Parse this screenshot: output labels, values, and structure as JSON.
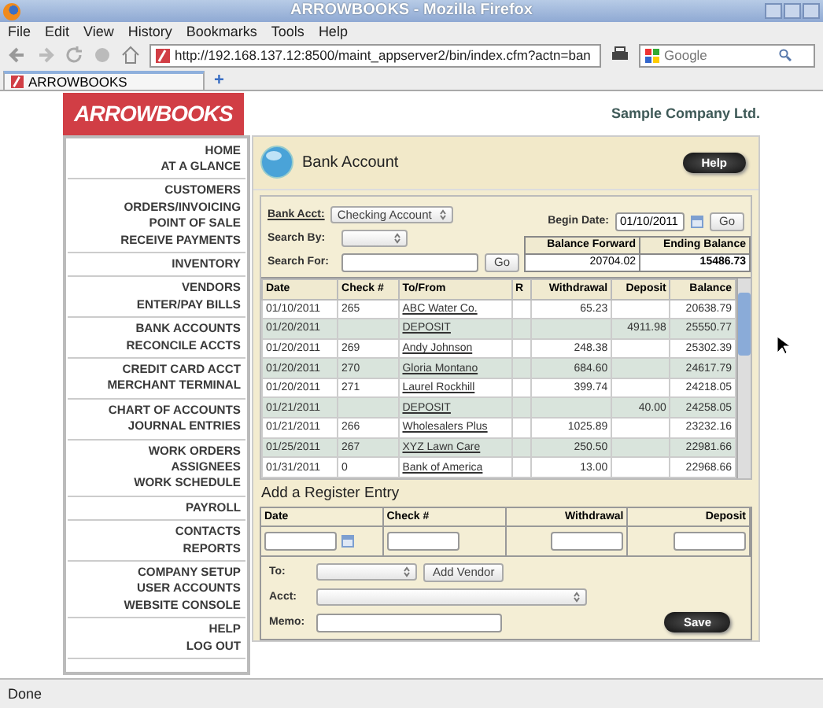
{
  "window": {
    "title": "ARROWBOOKS - Mozilla Firefox"
  },
  "menu": [
    "File",
    "Edit",
    "View",
    "History",
    "Bookmarks",
    "Tools",
    "Help"
  ],
  "address": {
    "value": "http://192.168.137.12:8500/maint_appserver2/bin/index.cfm?actn=ban"
  },
  "search": {
    "placeholder": "Google"
  },
  "tabs": [
    {
      "label": "ARROWBOOKS",
      "selected": true
    }
  ],
  "new_tab": "+",
  "header": {
    "logo": "ARROWBOOKS",
    "company": "Sample Company Ltd."
  },
  "sidebar": [
    [
      "HOME",
      "AT A GLANCE"
    ],
    [
      "CUSTOMERS",
      "ORDERS/INVOICING",
      "POINT OF SALE",
      "RECEIVE PAYMENTS"
    ],
    [
      "INVENTORY"
    ],
    [
      "VENDORS",
      "ENTER/PAY BILLS"
    ],
    [
      "BANK ACCOUNTS",
      "RECONCILE ACCTS"
    ],
    [
      "CREDIT CARD ACCT",
      "MERCHANT TERMINAL"
    ],
    [
      "CHART OF ACCOUNTS",
      "JOURNAL ENTRIES"
    ],
    [
      "WORK ORDERS",
      "ASSIGNEES",
      "WORK SCHEDULE"
    ],
    [
      "PAYROLL"
    ],
    [
      "CONTACTS",
      "REPORTS"
    ],
    [
      "COMPANY SETUP",
      "USER ACCOUNTS",
      "WEBSITE CONSOLE"
    ],
    [
      "HELP",
      "LOG OUT"
    ]
  ],
  "panel": {
    "title": "Bank Account",
    "help": "Help",
    "bank_acct": {
      "label": "Bank Acct:",
      "value": "Checking Account"
    },
    "search_by": {
      "label": "Search By:"
    },
    "search_for": {
      "label": "Search For:",
      "button": "Go"
    },
    "begin_date": {
      "label": "Begin Date:",
      "value": "01/10/2011",
      "button": "Go"
    },
    "balances": {
      "columns": [
        "Balance Forward",
        "Ending Balance"
      ],
      "values": [
        "20704.02",
        "15486.73"
      ]
    }
  },
  "register": {
    "columns": [
      "Date",
      "Check #",
      "To/From",
      "R",
      "Withdrawal",
      "Deposit",
      "Balance"
    ],
    "rows": [
      [
        "01/10/2011",
        "265",
        "ABC Water Co.",
        "",
        "65.23",
        "",
        "20638.79"
      ],
      [
        "01/20/2011",
        "",
        "DEPOSIT",
        "",
        "",
        "4911.98",
        "25550.77"
      ],
      [
        "01/20/2011",
        "269",
        "Andy Johnson",
        "",
        "248.38",
        "",
        "25302.39"
      ],
      [
        "01/20/2011",
        "270",
        "Gloria Montano",
        "",
        "684.60",
        "",
        "24617.79"
      ],
      [
        "01/20/2011",
        "271",
        "Laurel Rockhill",
        "",
        "399.74",
        "",
        "24218.05"
      ],
      [
        "01/21/2011",
        "",
        "DEPOSIT",
        "",
        "",
        "40.00",
        "24258.05"
      ],
      [
        "01/21/2011",
        "266",
        "Wholesalers Plus",
        "",
        "1025.89",
        "",
        "23232.16"
      ],
      [
        "01/25/2011",
        "267",
        "XYZ Lawn Care",
        "",
        "250.50",
        "",
        "22981.66"
      ],
      [
        "01/31/2011",
        "0",
        "Bank of America",
        "",
        "13.00",
        "",
        "22968.66"
      ]
    ]
  },
  "entry": {
    "title": "Add a Register Entry",
    "columns": [
      "Date",
      "Check #",
      "Withdrawal",
      "Deposit"
    ],
    "to_label": "To:",
    "add_vendor": "Add Vendor",
    "acct_label": "Acct:",
    "memo_label": "Memo:",
    "save": "Save"
  },
  "status_bar": "Done"
}
